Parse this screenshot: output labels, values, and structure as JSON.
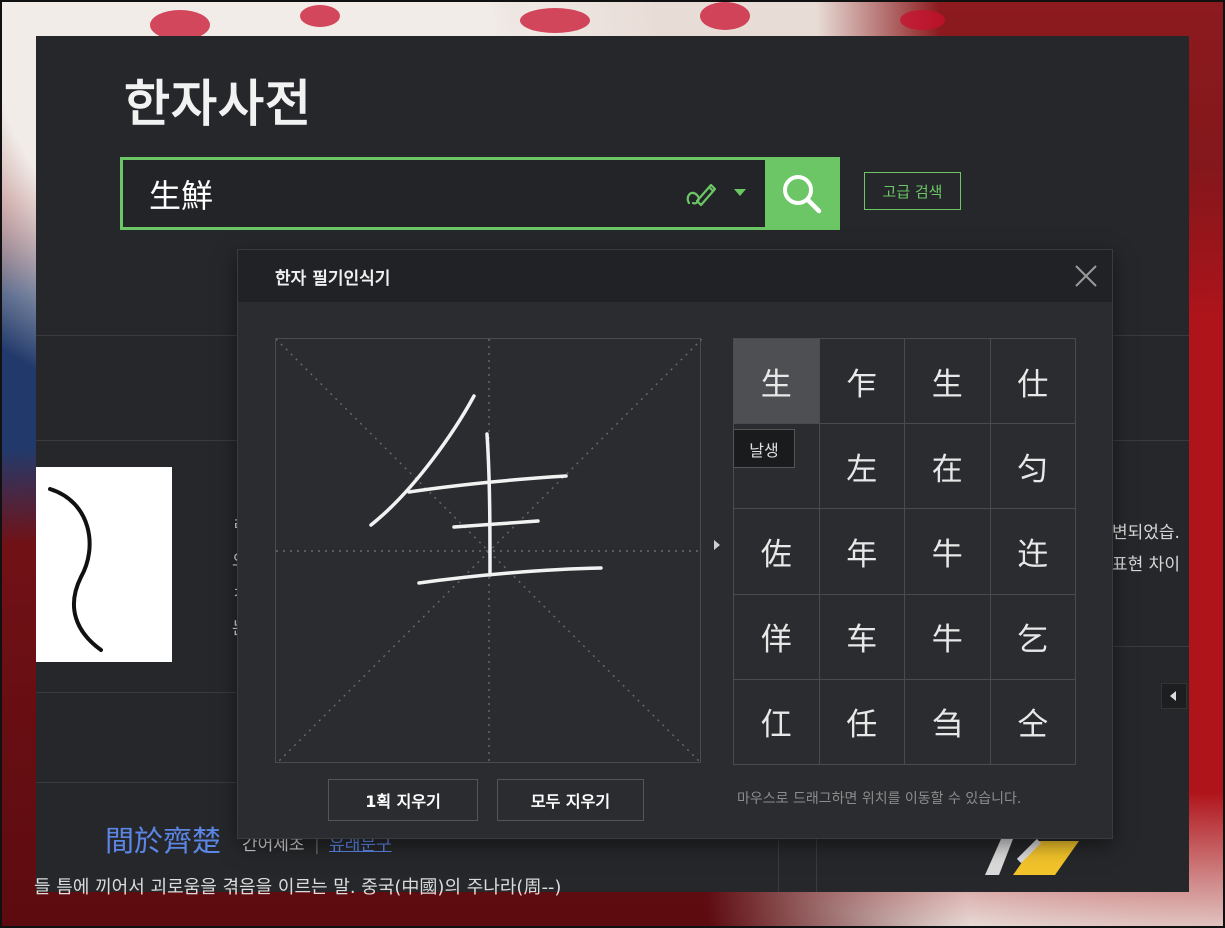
{
  "page": {
    "title": "한자사전"
  },
  "search": {
    "query": "生鮮",
    "advanced_label": "고급 검색"
  },
  "background_content": {
    "partial_lines": [
      "ㄹ",
      "으",
      "ㅊ",
      "는"
    ],
    "right_partial_1": "변되었습.",
    "right_partial_2": "표현 차이",
    "idiom_title": "間於齊楚",
    "idiom_reading": "간어제초",
    "idiom_link": "유래문구",
    "idiom_desc": "들 틈에 끼어서 괴로움을 겪음을 이르는 말. 중국(中國)의 주나라(周--)"
  },
  "handwriting": {
    "title": "한자 필기인식기",
    "candidates": [
      "生",
      "乍",
      "生",
      "仕",
      "",
      "左",
      "在",
      "匀",
      "佐",
      "年",
      "牛",
      "迕",
      "佯",
      "车",
      "牛",
      "乞",
      "仜",
      "任",
      "刍",
      "仝"
    ],
    "selected_index": 0,
    "tooltip": "날생",
    "erase_one_label": "1획 지우기",
    "erase_all_label": "모두 지우기",
    "hint": "마우스로 드래그하면 위치를 이동할 수 있습니다."
  },
  "colors": {
    "accent": "#6cc666",
    "panel": "#26272a",
    "link": "#5b86e5"
  },
  "icons": [
    "pen-icon",
    "search-icon",
    "close-icon"
  ]
}
